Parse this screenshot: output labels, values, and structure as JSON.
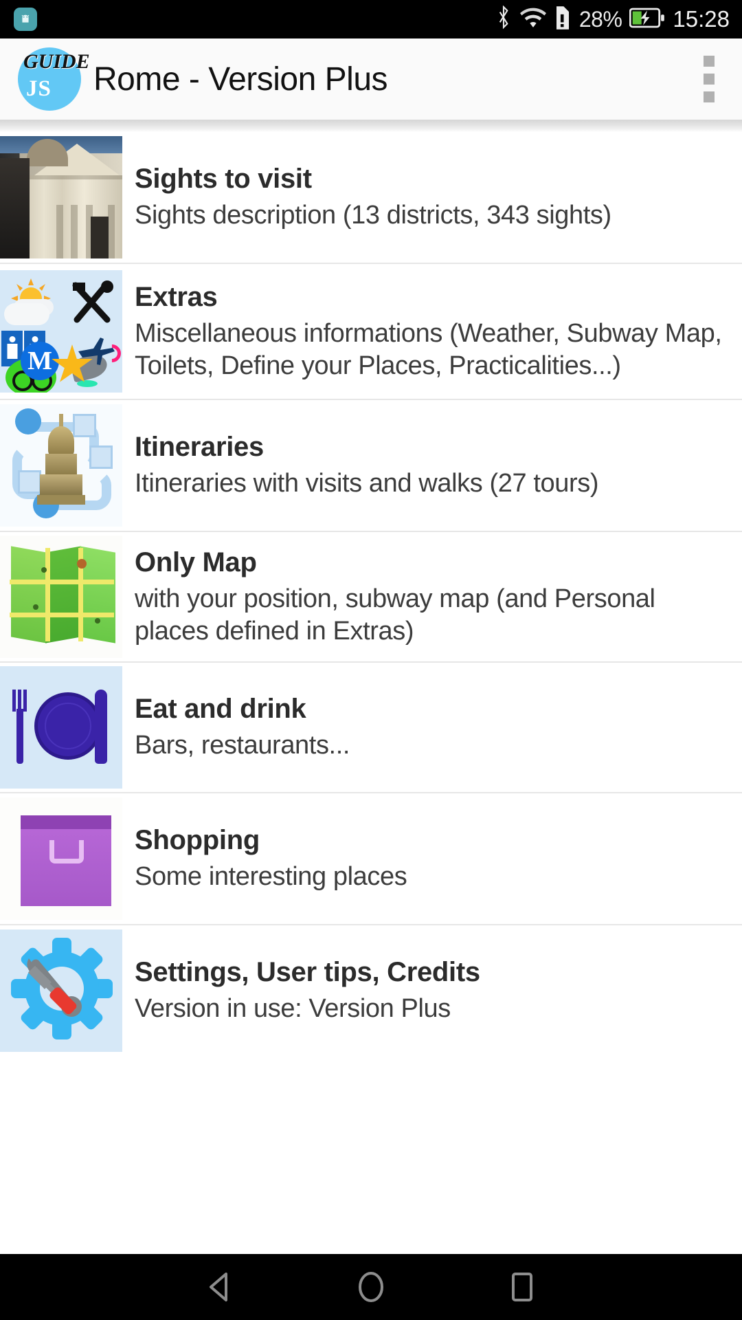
{
  "status_bar": {
    "battery_percent": "28%",
    "clock": "15:28",
    "icons": [
      "android-app-notification-icon",
      "bluetooth-icon",
      "wifi-icon",
      "sim-card-alert-icon",
      "battery-charging-icon"
    ]
  },
  "app_bar": {
    "logo_top": "GUIDE",
    "logo_bottom": "JS",
    "title": "Rome - Version Plus",
    "overflow_label": "More options"
  },
  "list": {
    "items": [
      {
        "title": "Sights to visit",
        "description": "Sights description (13 districts, 343 sights)",
        "icon": "church-facade-photo"
      },
      {
        "title": "Extras",
        "description": "Miscellaneous informations (Weather, Subway Map, Toilets, Define your Places, Practicalities...)",
        "icon": "extras-collage-icon"
      },
      {
        "title": "Itineraries",
        "description": "Itineraries with visits and walks (27 tours)",
        "icon": "route-monument-icon"
      },
      {
        "title": "Only Map",
        "description": "with your position, subway map (and Personal places defined in Extras)",
        "icon": "folded-map-icon"
      },
      {
        "title": "Eat and drink",
        "description": "Bars, restaurants...",
        "icon": "plate-fork-knife-icon"
      },
      {
        "title": "Shopping",
        "description": "Some interesting places",
        "icon": "shopping-bag-icon"
      },
      {
        "title": "Settings, User tips, Credits",
        "description": "Version in use: Version Plus",
        "icon": "gear-tools-icon"
      }
    ]
  },
  "nav_bar": {
    "back": "back-icon",
    "home": "home-icon",
    "recents": "recents-icon"
  },
  "colors": {
    "status_bar_bg": "#000000",
    "app_bar_bg": "#fafafa",
    "logo_circle": "#62c8f5",
    "icon_tile_bg": "#d6e8f7",
    "divider": "#e6e6e6",
    "title_text": "#2b2b2b",
    "desc_text": "#3c3c3c"
  }
}
